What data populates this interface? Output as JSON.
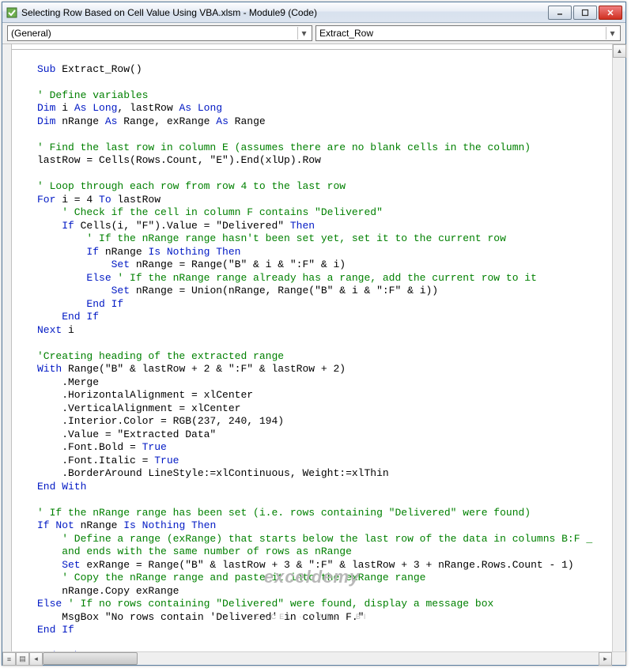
{
  "window": {
    "title": "Selecting Row Based on Cell Value Using VBA.xlsm - Module9 (Code)"
  },
  "dropdowns": {
    "object": "(General)",
    "procedure": "Extract_Row"
  },
  "code": {
    "l1a": "Sub",
    "l1b": " Extract_Row()",
    "l3": "' Define variables",
    "l4a": "Dim",
    "l4b": " i ",
    "l4c": "As Long",
    "l4d": ", lastRow ",
    "l4e": "As Long",
    "l5a": "Dim",
    "l5b": " nRange ",
    "l5c": "As",
    "l5d": " Range, exRange ",
    "l5e": "As",
    "l5f": " Range",
    "l7": "' Find the last row in column E (assumes there are no blank cells in the column)",
    "l8": "lastRow = Cells(Rows.Count, \"E\").End(xlUp).Row",
    "l10": "' Loop through each row from row 4 to the last row",
    "l11a": "For",
    "l11b": " i = 4 ",
    "l11c": "To",
    "l11d": " lastRow",
    "l12": "    ' Check if the cell in column F contains \"Delivered\"",
    "l13a": "    If",
    "l13b": " Cells(i, \"F\").Value = \"Delivered\" ",
    "l13c": "Then",
    "l14": "        ' If the nRange range hasn't been set yet, set it to the current row",
    "l15a": "        If",
    "l15b": " nRange ",
    "l15c": "Is Nothing Then",
    "l16a": "            Set",
    "l16b": " nRange = Range(\"B\" & i & \":F\" & i)",
    "l17a": "        Else ",
    "l17b": "' If the nRange range already has a range, add the current row to it",
    "l18a": "            Set",
    "l18b": " nRange = Union(nRange, Range(\"B\" & i & \":F\" & i))",
    "l19": "        End If",
    "l20": "    End If",
    "l21a": "Next",
    "l21b": " i",
    "l23": "'Creating heading of the extracted range",
    "l24a": "With",
    "l24b": " Range(\"B\" & lastRow + 2 & \":F\" & lastRow + 2)",
    "l25": "    .Merge",
    "l26": "    .HorizontalAlignment = xlCenter",
    "l27": "    .VerticalAlignment = xlCenter",
    "l28": "    .Interior.Color = RGB(237, 240, 194)",
    "l29": "    .Value = \"Extracted Data\"",
    "l30a": "    .Font.Bold = ",
    "l30b": "True",
    "l31a": "    .Font.Italic = ",
    "l31b": "True",
    "l32": "    .BorderAround LineStyle:=xlContinuous, Weight:=xlThin",
    "l33": "End With",
    "l35": "' If the nRange range has been set (i.e. rows containing \"Delivered\" were found)",
    "l36a": "If Not",
    "l36b": " nRange ",
    "l36c": "Is Nothing Then",
    "l37a": "    ' Define a range (exRange) that starts below the last row of the data in columns B:F _",
    "l37b": "    and ends with the same number of rows as nRange",
    "l38a": "    Set",
    "l38b": " exRange = Range(\"B\" & lastRow + 3 & \":F\" & lastRow + 3 + nRange.Rows.Count - 1)",
    "l39": "    ' Copy the nRange range and paste it into the exRange range",
    "l40": "    nRange.Copy exRange",
    "l41a": "Else ",
    "l41b": "' If no rows containing \"Delivered\" were found, display a message box",
    "l42": "    MsgBox \"No rows contain 'Delivered' in column F.\"",
    "l43": "End If",
    "l45": "End Sub"
  },
  "watermark": {
    "line1": "exceldemy",
    "line2": "EXCEL · DATA · BI"
  }
}
